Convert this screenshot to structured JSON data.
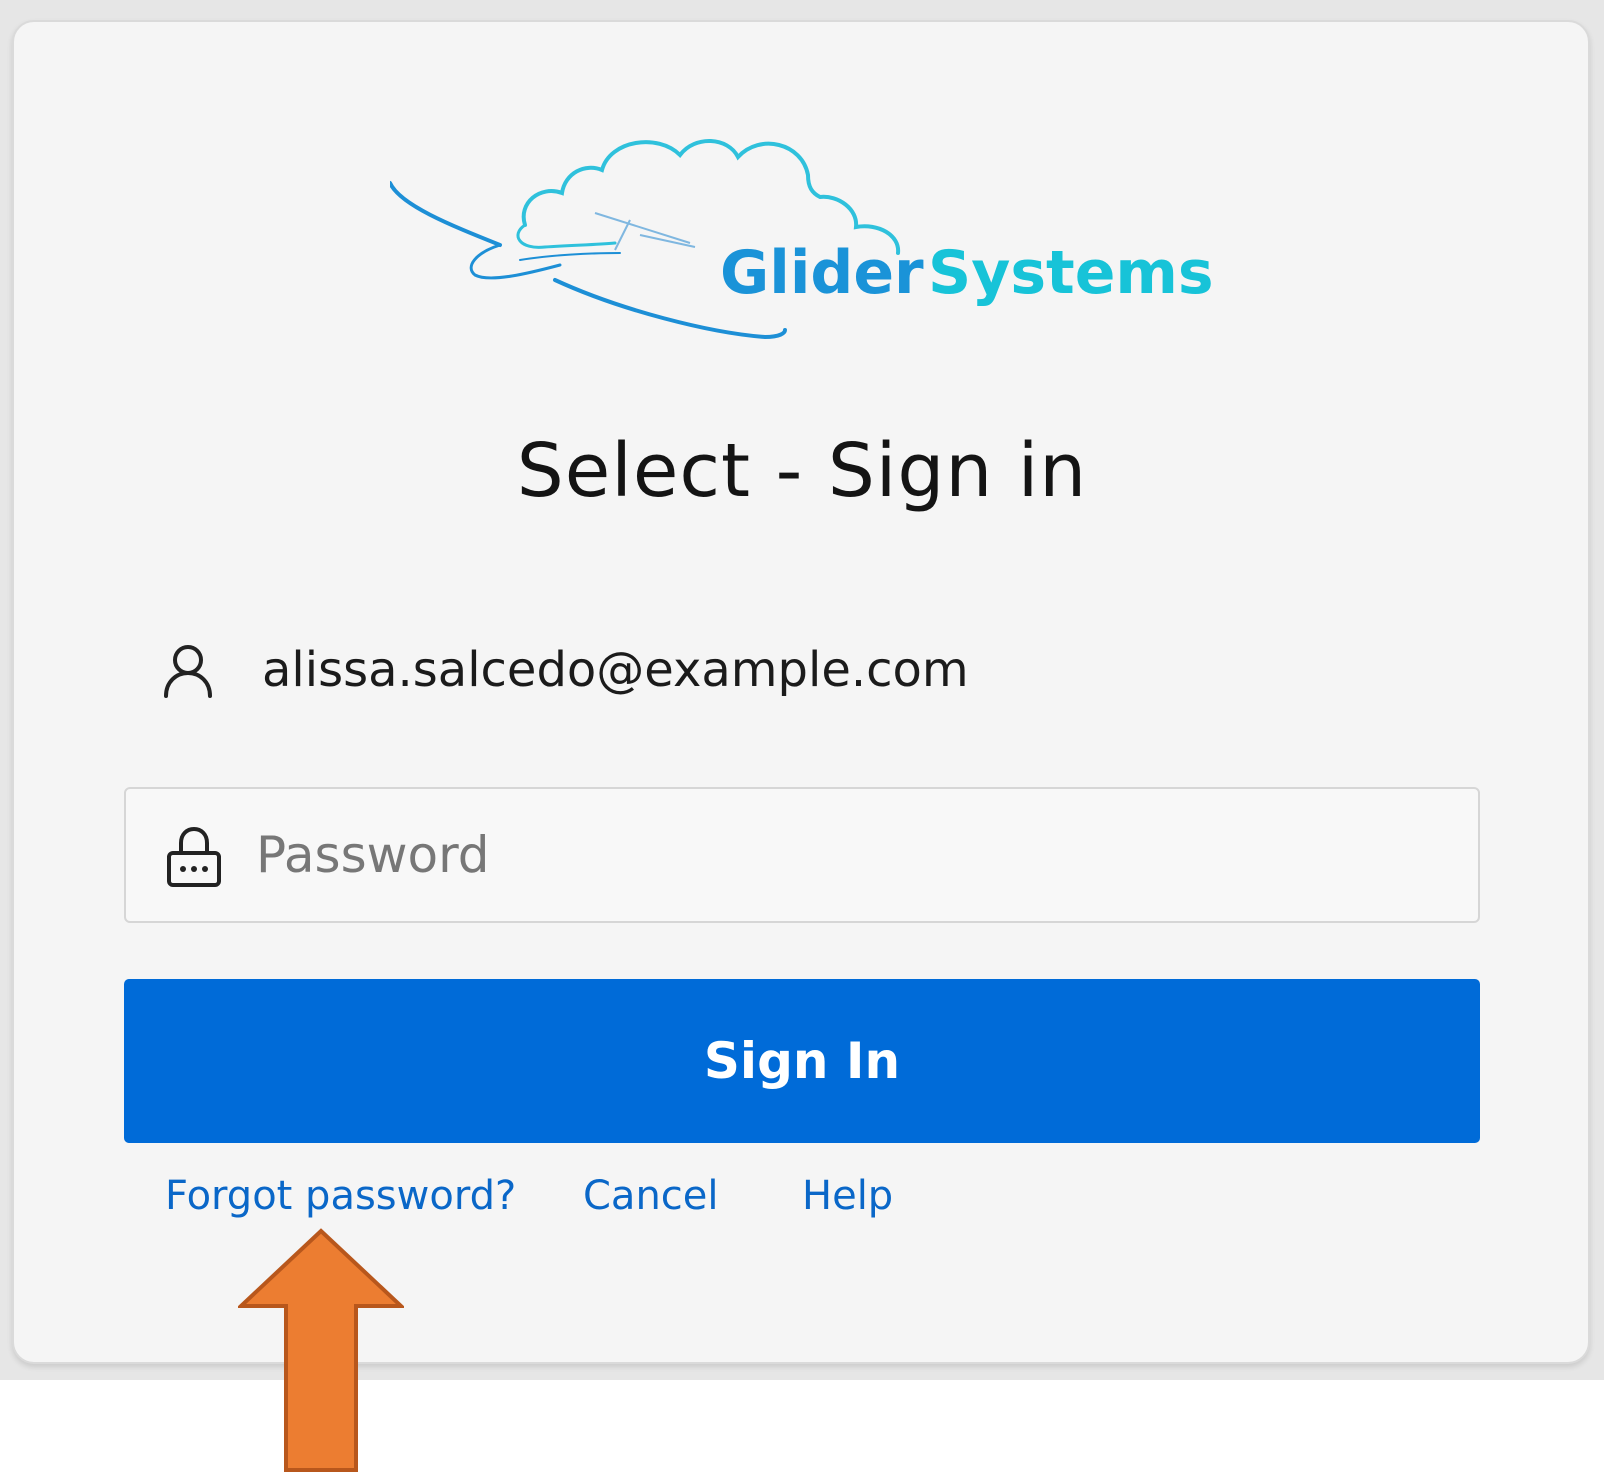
{
  "brand": {
    "name_part1": "Glider",
    "name_part2": "Systems",
    "colors": {
      "glider_blue": "#1a93d8",
      "systems_teal": "#17c3d8",
      "cloud": "#2fc1dc"
    },
    "icon": "glider-cloud-logo"
  },
  "page": {
    "title": "Select - Sign in"
  },
  "account": {
    "icon": "user-icon",
    "email": "alissa.salcedo@example.com"
  },
  "password": {
    "icon": "lock-icon",
    "placeholder": "Password",
    "value": ""
  },
  "actions": {
    "sign_in_label": "Sign In",
    "button_color": "#006bd8"
  },
  "links": {
    "forgot_password": "Forgot password?",
    "cancel": "Cancel",
    "help": "Help",
    "color": "#0a67c8"
  },
  "annotation": {
    "icon": "up-arrow",
    "color": "#ec7d31"
  }
}
